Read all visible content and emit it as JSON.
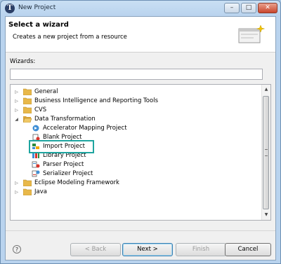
{
  "window": {
    "title": "New Project",
    "app_icon_glyph": "T",
    "controls": {
      "minimize": "–",
      "maximize": "□",
      "close": "✕"
    }
  },
  "header": {
    "title": "Select a wizard",
    "description": "Creates a new project from a resource"
  },
  "filter": {
    "label": "Wizards:",
    "value": ""
  },
  "tree": {
    "items": [
      {
        "label": "General",
        "type": "folder",
        "expander": "▷",
        "level": 0
      },
      {
        "label": "Business Intelligence and Reporting Tools",
        "type": "folder",
        "expander": "▷",
        "level": 0
      },
      {
        "label": "CVS",
        "type": "folder",
        "expander": "▷",
        "level": 0
      },
      {
        "label": "Data Transformation",
        "type": "folder",
        "expander": "◢",
        "level": 0
      },
      {
        "label": "Accelerator Mapping Project",
        "type": "project",
        "expander": "",
        "level": 1
      },
      {
        "label": "Blank Project",
        "type": "project",
        "expander": "",
        "level": 1
      },
      {
        "label": "Import Project",
        "type": "project",
        "expander": "",
        "level": 1,
        "selected": true
      },
      {
        "label": "Library Project",
        "type": "project",
        "expander": "",
        "level": 1
      },
      {
        "label": "Parser Project",
        "type": "project",
        "expander": "",
        "level": 1
      },
      {
        "label": "Serializer Project",
        "type": "project",
        "expander": "",
        "level": 1
      },
      {
        "label": "Eclipse Modeling Framework",
        "type": "folder",
        "expander": "▷",
        "level": 0
      },
      {
        "label": "Java",
        "type": "folder",
        "expander": "▷",
        "level": 0
      }
    ],
    "scroll": {
      "up": "▲",
      "down": "▼"
    }
  },
  "buttons": {
    "help": "?",
    "back": "< Back",
    "next": "Next >",
    "finish": "Finish",
    "cancel": "Cancel"
  },
  "colors": {
    "selection_highlight": "#1fa5a0",
    "folder": "#e8b84a"
  }
}
